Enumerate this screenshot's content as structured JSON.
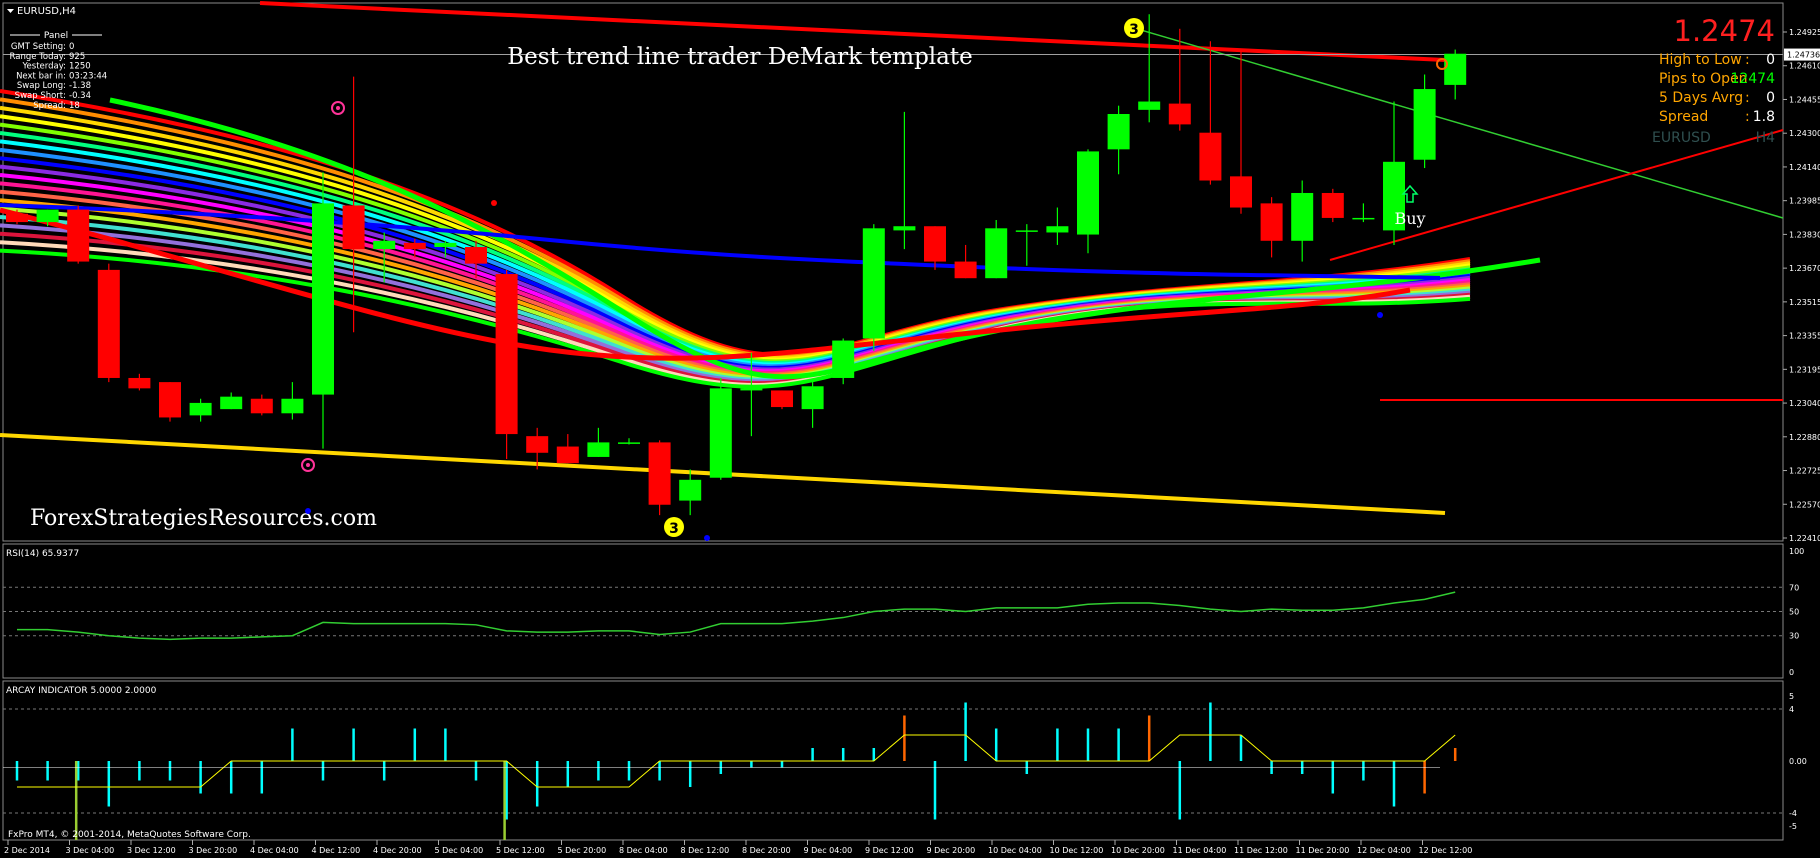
{
  "window": {
    "symbol_title": "EURUSD,H4",
    "copyright": "FxPro MT4, © 2001-2014, MetaQuotes Software Corp."
  },
  "chart_title": "Best trend line trader DeMark template",
  "watermark": "ForexStrategiesResources.com",
  "panel": {
    "heading": "Panel",
    "rows": [
      {
        "label": "GMT Setting:",
        "value": "0"
      },
      {
        "label": "Range Today:",
        "value": "925"
      },
      {
        "label": "Yesterday:",
        "value": "1250"
      },
      {
        "label": "Next bar in:",
        "value": "03:23:44"
      },
      {
        "label": "Swap Long:",
        "value": "-1.38"
      },
      {
        "label": "Swap Short:",
        "value": "-0.34"
      },
      {
        "label": "Spread:",
        "value": "18"
      }
    ]
  },
  "info_box": {
    "price": "1.2474",
    "rows": [
      {
        "label": "High to Low",
        "sep": ":",
        "value": "0"
      },
      {
        "label": "Pips to Open",
        "sep": "",
        "value": "12474"
      },
      {
        "label": "5 Days Avrg",
        "sep": ":",
        "value": "0"
      },
      {
        "label": "Spread",
        "sep": ":",
        "value": "1.8"
      }
    ],
    "symbol": "EURUSD",
    "timeframe": "H4"
  },
  "current_price_label": "1.24736",
  "price_axis": [
    "1.24925",
    "1.24610",
    "1.24455",
    "1.24300",
    "1.24140",
    "1.23985",
    "1.23830",
    "1.23670",
    "1.23515",
    "1.23355",
    "1.23195",
    "1.23040",
    "1.22880",
    "1.22725",
    "1.22570",
    "1.22410"
  ],
  "time_axis": [
    "2 Dec 2014",
    "3 Dec 04:00",
    "3 Dec 12:00",
    "3 Dec 20:00",
    "4 Dec 04:00",
    "4 Dec 12:00",
    "4 Dec 20:00",
    "5 Dec 04:00",
    "5 Dec 12:00",
    "5 Dec 20:00",
    "8 Dec 04:00",
    "8 Dec 12:00",
    "8 Dec 20:00",
    "9 Dec 04:00",
    "9 Dec 12:00",
    "9 Dec 20:00",
    "10 Dec 04:00",
    "10 Dec 12:00",
    "10 Dec 20:00",
    "11 Dec 04:00",
    "11 Dec 12:00",
    "11 Dec 20:00",
    "12 Dec 04:00",
    "12 Dec 12:00"
  ],
  "signals": {
    "buy_label": "Buy",
    "demark_top": "3",
    "demark_bottom": "3"
  },
  "rsi": {
    "label": "RSI(14) 65.9377",
    "levels": [
      "100",
      "70",
      "50",
      "30",
      "0"
    ]
  },
  "arcay": {
    "label": "ARCAY INDICATOR 5.0000 2.0000",
    "levels": [
      "5",
      "4",
      "0.00",
      "-4",
      "-5"
    ]
  },
  "colors": {
    "bull": "#00ff00",
    "bear": "#ff0000",
    "rsi_line": "#32cd32",
    "arcay_hist": "#00ffff",
    "arcay_signal": "#ff6600",
    "arcay_line": "#ffff00"
  },
  "chart_data": {
    "type": "candlestick",
    "symbol": "EURUSD",
    "timeframe": "H4",
    "candles": [
      {
        "o": 1.2397,
        "h": 1.2399,
        "l": 1.2392,
        "c": 1.2393
      },
      {
        "o": 1.2393,
        "h": 1.2399,
        "l": 1.2391,
        "c": 1.2399
      },
      {
        "o": 1.2399,
        "h": 1.2401,
        "l": 1.2373,
        "c": 1.2374
      },
      {
        "o": 1.237,
        "h": 1.2373,
        "l": 1.2316,
        "c": 1.2318
      },
      {
        "o": 1.2318,
        "h": 1.232,
        "l": 1.2312,
        "c": 1.2313
      },
      {
        "o": 1.2316,
        "h": 1.2316,
        "l": 1.2297,
        "c": 1.2299
      },
      {
        "o": 1.23,
        "h": 1.2308,
        "l": 1.2297,
        "c": 1.2306
      },
      {
        "o": 1.2303,
        "h": 1.2311,
        "l": 1.2303,
        "c": 1.2309
      },
      {
        "o": 1.2308,
        "h": 1.231,
        "l": 1.23,
        "c": 1.2301
      },
      {
        "o": 1.2301,
        "h": 1.2316,
        "l": 1.2298,
        "c": 1.2308
      },
      {
        "o": 1.231,
        "h": 1.2417,
        "l": 1.2284,
        "c": 1.2402
      },
      {
        "o": 1.2401,
        "h": 1.2463,
        "l": 1.234,
        "c": 1.238
      },
      {
        "o": 1.238,
        "h": 1.2388,
        "l": 1.2364,
        "c": 1.2384
      },
      {
        "o": 1.2383,
        "h": 1.2385,
        "l": 1.2376,
        "c": 1.238
      },
      {
        "o": 1.2381,
        "h": 1.2384,
        "l": 1.2376,
        "c": 1.2383
      },
      {
        "o": 1.2381,
        "h": 1.2384,
        "l": 1.2366,
        "c": 1.2373
      },
      {
        "o": 1.2368,
        "h": 1.237,
        "l": 1.2279,
        "c": 1.2291
      },
      {
        "o": 1.229,
        "h": 1.2294,
        "l": 1.2274,
        "c": 1.2282
      },
      {
        "o": 1.2285,
        "h": 1.2291,
        "l": 1.2277,
        "c": 1.2277
      },
      {
        "o": 1.228,
        "h": 1.2294,
        "l": 1.228,
        "c": 1.2287
      },
      {
        "o": 1.2287,
        "h": 1.2289,
        "l": 1.2286,
        "c": 1.2287
      },
      {
        "o": 1.2287,
        "h": 1.2288,
        "l": 1.2252,
        "c": 1.2257
      },
      {
        "o": 1.2259,
        "h": 1.2274,
        "l": 1.2252,
        "c": 1.2269
      },
      {
        "o": 1.227,
        "h": 1.2318,
        "l": 1.2269,
        "c": 1.2313
      },
      {
        "o": 1.2312,
        "h": 1.233,
        "l": 1.229,
        "c": 1.2313
      },
      {
        "o": 1.2312,
        "h": 1.2312,
        "l": 1.2303,
        "c": 1.2304
      },
      {
        "o": 1.2303,
        "h": 1.2317,
        "l": 1.2294,
        "c": 1.2314
      },
      {
        "o": 1.2318,
        "h": 1.2337,
        "l": 1.2315,
        "c": 1.2336
      },
      {
        "o": 1.2337,
        "h": 1.2392,
        "l": 1.2331,
        "c": 1.239
      },
      {
        "o": 1.2389,
        "h": 1.2446,
        "l": 1.238,
        "c": 1.2391
      },
      {
        "o": 1.2391,
        "h": 1.2391,
        "l": 1.237,
        "c": 1.2374
      },
      {
        "o": 1.2374,
        "h": 1.2382,
        "l": 1.2366,
        "c": 1.2366
      },
      {
        "o": 1.2366,
        "h": 1.2394,
        "l": 1.2366,
        "c": 1.239
      },
      {
        "o": 1.2389,
        "h": 1.2392,
        "l": 1.2372,
        "c": 1.2389
      },
      {
        "o": 1.2388,
        "h": 1.24,
        "l": 1.2382,
        "c": 1.2391
      },
      {
        "o": 1.2387,
        "h": 1.2428,
        "l": 1.2378,
        "c": 1.2427
      },
      {
        "o": 1.2428,
        "h": 1.2449,
        "l": 1.2416,
        "c": 1.2445
      },
      {
        "o": 1.2447,
        "h": 1.2493,
        "l": 1.2441,
        "c": 1.2451
      },
      {
        "o": 1.245,
        "h": 1.2486,
        "l": 1.2437,
        "c": 1.244
      },
      {
        "o": 1.2436,
        "h": 1.248,
        "l": 1.2411,
        "c": 1.2413
      },
      {
        "o": 1.2415,
        "h": 1.2475,
        "l": 1.2397,
        "c": 1.24
      },
      {
        "o": 1.2402,
        "h": 1.2405,
        "l": 1.2376,
        "c": 1.2384
      },
      {
        "o": 1.2384,
        "h": 1.2413,
        "l": 1.2374,
        "c": 1.2407
      },
      {
        "o": 1.2407,
        "h": 1.2409,
        "l": 1.2393,
        "c": 1.2395
      },
      {
        "o": 1.2395,
        "h": 1.2402,
        "l": 1.2393,
        "c": 1.2395
      },
      {
        "o": 1.2389,
        "h": 1.2451,
        "l": 1.2382,
        "c": 1.2422
      },
      {
        "o": 1.2423,
        "h": 1.2464,
        "l": 1.2419,
        "c": 1.2457
      },
      {
        "o": 1.2459,
        "h": 1.2476,
        "l": 1.2452,
        "c": 1.2474
      }
    ],
    "rsi_values": [
      35,
      35,
      33,
      30,
      28,
      27,
      28,
      28,
      29,
      30,
      41,
      40,
      40,
      40,
      40,
      39,
      34,
      33,
      33,
      34,
      34,
      31,
      33,
      40,
      40,
      40,
      42,
      45,
      50,
      52,
      52,
      50,
      53,
      53,
      53,
      56,
      57,
      57,
      55,
      52,
      50,
      52,
      51,
      51,
      53,
      57,
      60,
      66
    ],
    "arcay_values": [
      -1.5,
      -1.5,
      -1.5,
      -3.5,
      -1.5,
      -1.5,
      -2.5,
      -2.5,
      -2.5,
      2.5,
      -1.5,
      2.5,
      -1.5,
      2.5,
      2.5,
      -1.5,
      -4.5,
      -3.5,
      -2,
      -1.5,
      -1.5,
      -1.5,
      -2,
      -1,
      -0.5,
      -0.5,
      1,
      1,
      1,
      3.5,
      -4.5,
      4.5,
      2.5,
      -1,
      2.5,
      2.5,
      2.5,
      3.5,
      -4.5,
      4.5,
      2,
      -1,
      -1,
      -2.5,
      -1.5,
      -3.5,
      -2.5,
      1
    ],
    "arcay_signals": [
      29,
      37,
      46,
      47
    ],
    "arcay_line_values": [
      -2,
      -2,
      -2,
      -2,
      -2,
      -2,
      -2,
      0,
      0,
      0,
      0,
      0,
      0,
      0,
      0,
      0,
      0,
      -2,
      -2,
      -2,
      -2,
      0,
      0,
      0,
      0,
      0,
      0,
      0,
      0,
      2,
      2,
      2,
      0,
      0,
      0,
      0,
      0,
      0,
      2,
      2,
      2,
      0,
      0,
      0,
      0,
      0,
      0,
      2
    ],
    "price_range": [
      1.2241,
      1.2496
    ]
  }
}
